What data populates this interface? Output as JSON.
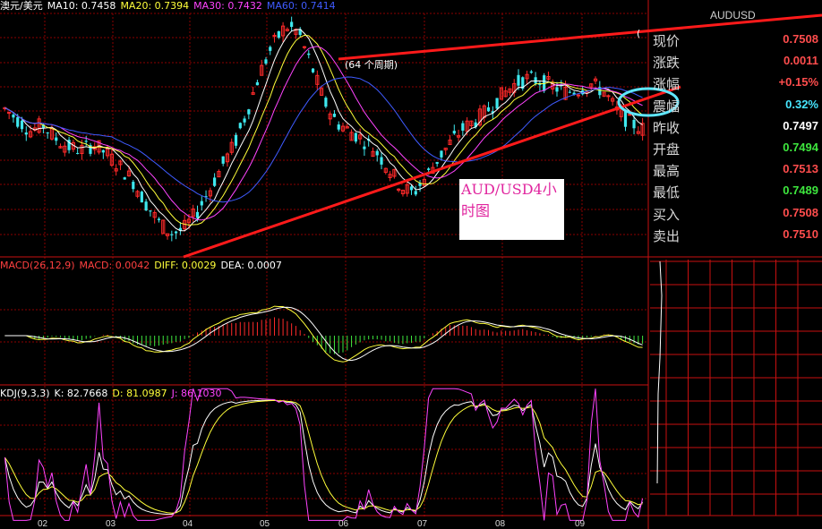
{
  "header_main": [
    {
      "text": "澳元/美元",
      "color": "#ffffff"
    },
    {
      "text": "MA10: 0.7458",
      "color": "#ffffff"
    },
    {
      "text": "MA20: 0.7394",
      "color": "#ffff3a"
    },
    {
      "text": "MA30: 0.7432",
      "color": "#ff44ff"
    },
    {
      "text": "MA60: 0.7414",
      "color": "#3f5bff"
    }
  ],
  "header_macd": [
    {
      "text": "MACD(26,12,9)",
      "color": "#ff4040"
    },
    {
      "text": "MACD: 0.0042",
      "color": "#ff4040"
    },
    {
      "text": "DIFF: 0.0029",
      "color": "#ffff3a"
    },
    {
      "text": "DEA: 0.0007",
      "color": "#ffffff"
    }
  ],
  "header_kdj": [
    {
      "text": "KDJ(9,3,3)",
      "color": "#ffffff"
    },
    {
      "text": "K: 82.7668",
      "color": "#ffffff"
    },
    {
      "text": "D: 81.0987",
      "color": "#ffff3a"
    },
    {
      "text": "J: 86.1030",
      "color": "#ff44ff"
    }
  ],
  "symbol": "AUDUSD",
  "quote": [
    {
      "label": "现价",
      "value": "0.7508",
      "color": "#ff4d4d"
    },
    {
      "label": "涨跌",
      "value": "0.0011",
      "color": "#ff4d4d"
    },
    {
      "label": "涨幅",
      "value": "+0.15%",
      "color": "#ff4d4d"
    },
    {
      "label": "震幅",
      "value": "0.32%",
      "color": "#47e6ff"
    },
    {
      "label": "昨收",
      "value": "0.7497",
      "color": "#ffffff"
    },
    {
      "label": "开盘",
      "value": "0.7494",
      "color": "#3ee63e"
    },
    {
      "label": "最高",
      "value": "0.7513",
      "color": "#ff4d4d"
    },
    {
      "label": "最低",
      "value": "0.7489",
      "color": "#3ee63e"
    },
    {
      "label": "买入",
      "value": "0.7508",
      "color": "#ff4d4d"
    },
    {
      "label": "卖出",
      "value": "0.7510",
      "color": "#ff4d4d"
    }
  ],
  "annotation": {
    "line1": "AUD/USD4小",
    "line2": "时图"
  },
  "period_note": "(64 个周期)",
  "fragment": "(",
  "colors": {
    "up": "#ff2a2a",
    "down": "#3ee8ee",
    "grid": "#8b0000",
    "trend": "#ff1a1a",
    "ellipse": "#5fe7ff"
  },
  "chart_data": {
    "type": "candlestick",
    "categories": [
      "02",
      "03",
      "04",
      "05",
      "06",
      "07",
      "08",
      "09"
    ],
    "main_series": [
      {
        "name": "MA10",
        "value": 0.7458
      },
      {
        "name": "MA20",
        "value": 0.7394
      },
      {
        "name": "MA30",
        "value": 0.7432
      },
      {
        "name": "MA60",
        "value": 0.7414
      }
    ],
    "price_path": [
      0.7545,
      0.7525,
      0.7505,
      0.7515,
      0.749,
      0.7475,
      0.747,
      0.748,
      0.7462,
      0.744,
      0.7415,
      0.7375,
      0.734,
      0.7318,
      0.7325,
      0.7355,
      0.7395,
      0.744,
      0.748,
      0.754,
      0.761,
      0.766,
      0.7695,
      0.7685,
      0.7625,
      0.756,
      0.752,
      0.7505,
      0.749,
      0.747,
      0.744,
      0.7405,
      0.739,
      0.742,
      0.7455,
      0.7485,
      0.751,
      0.7525,
      0.7545,
      0.757,
      0.759,
      0.76,
      0.7595,
      0.7585,
      0.7575,
      0.758,
      0.759,
      0.7575,
      0.754,
      0.752,
      0.7508
    ],
    "macd": {
      "DIFF": 0.0029,
      "DEA": 0.0007,
      "MACD": 0.0042
    },
    "kdj": {
      "K": 82.7668,
      "D": 81.0987,
      "J": 86.103
    }
  }
}
